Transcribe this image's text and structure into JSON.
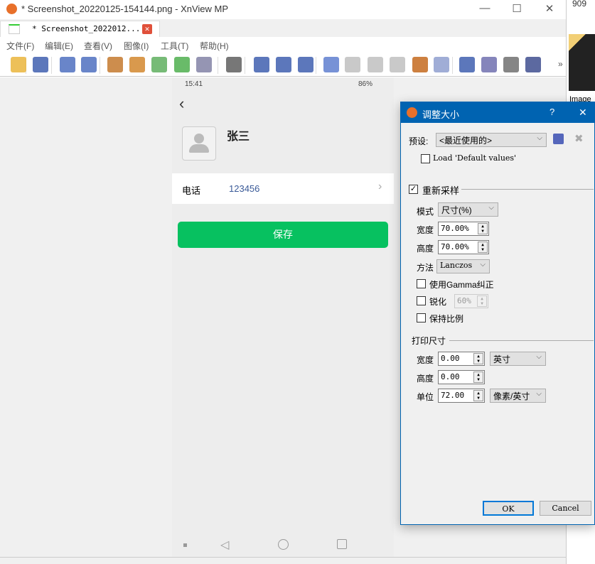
{
  "window": {
    "title": "* Screenshot_20220125-154144.png - XnView MP",
    "minimize": "—",
    "maximize": "☐",
    "close": "✕"
  },
  "tab": {
    "label": "* Screenshot_2022012...",
    "close": "✕"
  },
  "menu": [
    "文件(F)",
    "编辑(E)",
    "查看(V)",
    "图像(I)",
    "工具(T)",
    "帮助(H)"
  ],
  "toolbar": {
    "overflow": "»",
    "icons": [
      "browser-icon",
      "save-icon",
      "undo-icon",
      "redo-icon",
      "crop-icon",
      "resize-icon",
      "rotate-left-icon",
      "rotate-right-icon",
      "color-adjust-icon",
      "curves-icon",
      "zoom-in-icon",
      "zoom-actual-icon",
      "zoom-out-icon",
      "previous-icon",
      "next-icon",
      "first-page-icon",
      "last-page-icon",
      "slideshow-icon",
      "info-icon",
      "fullscreen-icon",
      "edit-text-icon",
      "print-icon",
      "scan-icon"
    ]
  },
  "rightpane": {
    "breadcrumb": "909",
    "thumb_label": "Image"
  },
  "phone": {
    "time": "15:41",
    "battery": "86%",
    "back": "‹",
    "name": "张三",
    "phone_label": "电话",
    "phone_value": "123456",
    "save": "保存"
  },
  "dialog": {
    "title": "调整大小",
    "help": "?",
    "close": "✕",
    "preset_label": "预设:",
    "preset_value": "<最近使用的>",
    "load_default": "Load 'Default values'",
    "resample": {
      "label": "重新采样",
      "checked": true,
      "mode_label": "模式",
      "mode_value": "尺寸(%)",
      "width_label": "宽度",
      "width_value": "70.00%",
      "height_label": "高度",
      "height_value": "70.00%",
      "method_label": "方法",
      "method_value": "Lanczos",
      "gamma": "使用Gamma纠正",
      "sharpen": "锐化",
      "sharpen_value": "60%",
      "keep_ratio": "保持比例"
    },
    "print": {
      "label": "打印尺寸",
      "width_label": "宽度",
      "width_value": "0.00",
      "width_unit": "英寸",
      "height_label": "高度",
      "height_value": "0.00",
      "unit_label": "单位",
      "unit_value": "72.00",
      "unit_unit": "像素/英寸"
    },
    "ok": "OK",
    "cancel": "Cancel"
  }
}
